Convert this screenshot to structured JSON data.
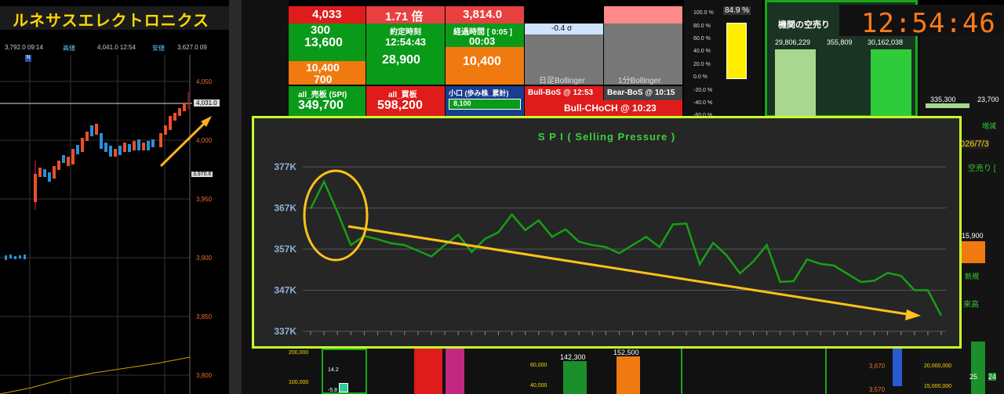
{
  "header": {
    "company_title": "ルネサスエレクトロニクス",
    "clock": "12:54:46"
  },
  "price_chart": {
    "ohlc_bar": {
      "open": "3,792.0 09:14",
      "high_label": "高値",
      "high": "4,041.0 12:54",
      "close_label": "安値",
      "low": "3,627.0 09"
    },
    "marker": "N",
    "current_price_tag": "4,031.0",
    "secondary_tag": "3,970.6",
    "y_ticks": [
      "4,050",
      "4,000",
      "3,950",
      "3,900",
      "3,850",
      "3,800"
    ]
  },
  "dashboard": {
    "top_row": {
      "col1_value": "4,033",
      "col2_value": "1.71 倍",
      "col3_value": "3,814.0"
    },
    "row2": {
      "col1a": "300",
      "col1b": "13,600",
      "yakutei_label": "約定時刻",
      "yakutei_time": "12:54:43",
      "keika_label": "経過時間 [ 0:05 ]",
      "keika_time": "00:03",
      "sigma": "-0.4 σ",
      "bollinger_daily": "日足Bollinger",
      "bollinger_1m": "1分Bollinger"
    },
    "row3": {
      "col1a": "10,400",
      "col1b": "700",
      "col2": "28,900",
      "col3": "10,400"
    },
    "row4": {
      "spi_label": "all_売板 (SPI)",
      "spi_value": "349,700",
      "buy_label": "all_買板",
      "buy_value": "598,200",
      "small_label": "小口 (歩み株_累計)",
      "small_value": "8,100",
      "bull_bos": "Bull-BoS @ 12:53",
      "bear_bos": "Bear-BoS @ 10:15",
      "bull_choch": "Bull-CHoCH @ 10:23"
    },
    "percent_scale": [
      "100.0 %",
      "80.0 %",
      "60.0 %",
      "40.0 %",
      "20.0 %",
      "0.0 %",
      "-20.0 %",
      "-40.0 %",
      "-60.0 %"
    ],
    "gauge_value": "84.9 %",
    "gauge_fraction": 0.849,
    "short_panel": {
      "title": "機関の空売り",
      "values": [
        "29,806,229",
        "355,809",
        "30,162,038"
      ]
    },
    "right_panel": {
      "values": [
        "335,300",
        "23,700"
      ],
      "zoukan": "増減",
      "date": "026/7/3",
      "karauri": "空売り [",
      "v15900": "15,900",
      "shinki": "新規",
      "raidaka": "来高"
    },
    "bottom": {
      "left_scale": [
        "200,000",
        "100,000"
      ],
      "small_nums": [
        "14.2",
        "-5.8"
      ],
      "mid_scale": [
        "60,000",
        "40,000"
      ],
      "vol1": "142,300",
      "vol2": "152,500",
      "price_levels": [
        "3,670",
        "3,570"
      ],
      "right_scale": [
        "20,000,000",
        "15,000,000"
      ],
      "cut_values": [
        "25",
        "24"
      ]
    },
    "colors": {
      "green": "#0a9a1a",
      "orange": "#f07a10",
      "red": "#e01b1b",
      "accent_lime": "#c8ff2c",
      "clock_orange": "#ff7a1a"
    }
  },
  "chart_data": {
    "type": "line",
    "title": "S P I ( Selling Pressure )",
    "xlabel": "",
    "ylabel": "",
    "y_ticks": [
      "377K",
      "367K",
      "357K",
      "347K",
      "337K"
    ],
    "ylim": [
      337000,
      377000
    ],
    "grid": true,
    "series": [
      {
        "values": [
          366800,
          373400,
          366000,
          358000,
          360200,
          359400,
          358400,
          358000,
          356600,
          355200,
          358000,
          360500,
          356300,
          359500,
          361100,
          365400,
          361600,
          364000,
          360000,
          361800,
          358800,
          358000,
          357500,
          356000,
          358000,
          360000,
          357500,
          363000,
          363200,
          353300,
          358500,
          355500,
          351100,
          354000,
          358000,
          349000,
          349200,
          354500,
          353400,
          353000,
          351000,
          349000,
          349300,
          351200,
          350500,
          347000,
          347000,
          340800
        ]
      }
    ],
    "annotations": [
      "yellow ellipse around early peak",
      "yellow downward trend arrow"
    ]
  }
}
